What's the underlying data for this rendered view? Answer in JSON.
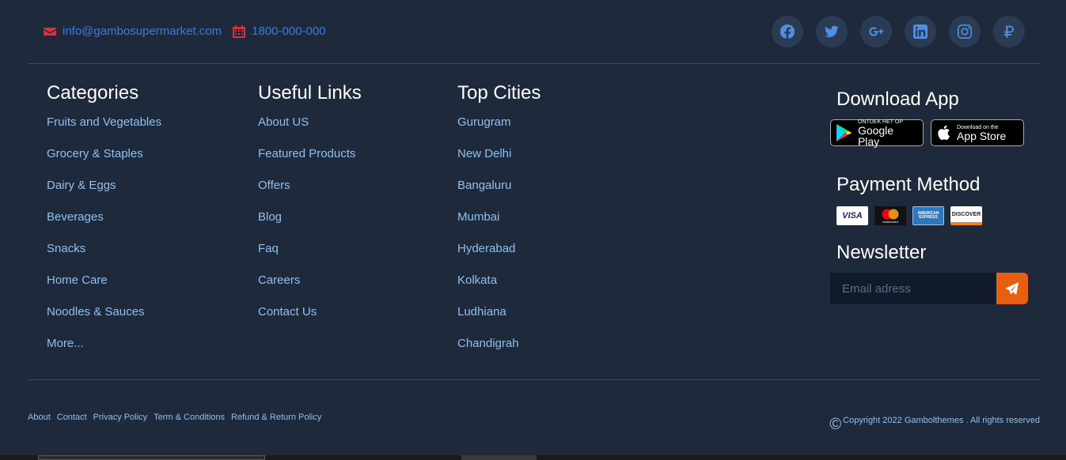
{
  "contact": {
    "email": "info@gambosupermarket.com",
    "phone": "1800-000-000"
  },
  "social": [
    "facebook-icon",
    "twitter-icon",
    "google-plus-icon",
    "linkedin-icon",
    "instagram-icon",
    "ruble-icon"
  ],
  "categories": {
    "title": "Categories",
    "items": [
      "Fruits and Vegetables",
      "Grocery & Staples",
      "Dairy & Eggs",
      "Beverages",
      "Snacks",
      "Home Care",
      "Noodles & Sauces",
      "More..."
    ]
  },
  "useful_links": {
    "title": "Useful Links",
    "items": [
      "About US",
      "Featured Products",
      "Offers",
      "Blog",
      "Faq",
      "Careers",
      "Contact Us"
    ]
  },
  "top_cities": {
    "title": "Top Cities",
    "items": [
      "Gurugram",
      "New Delhi",
      "Bangaluru",
      "Mumbai",
      "Hyderabad",
      "Kolkata",
      "Ludhiana",
      "Chandigrah"
    ]
  },
  "download": {
    "title": "Download App",
    "google_small": "ONTDEK HET OP",
    "google_big": "Google Play",
    "apple_small": "Download on the",
    "apple_big": "App Store"
  },
  "payment": {
    "title": "Payment Method",
    "cards": [
      "VISA",
      "mastercard",
      "AMERICAN EXPRESS",
      "DISCOVER"
    ]
  },
  "newsletter": {
    "title": "Newsletter",
    "placeholder": "Email adress"
  },
  "bottom_links": [
    "About",
    "Contact",
    "Privacy Policy",
    "Term & Conditions",
    "Refund & Return Policy"
  ],
  "copyright": {
    "symbol": "©",
    "text": "Copyright 2022 Gambolthemes . All rights reserved"
  },
  "colors": {
    "background": "#1e293c",
    "link": "#8fc0ee",
    "accent": "#e8600f",
    "contact_icon": "#d6323a"
  }
}
